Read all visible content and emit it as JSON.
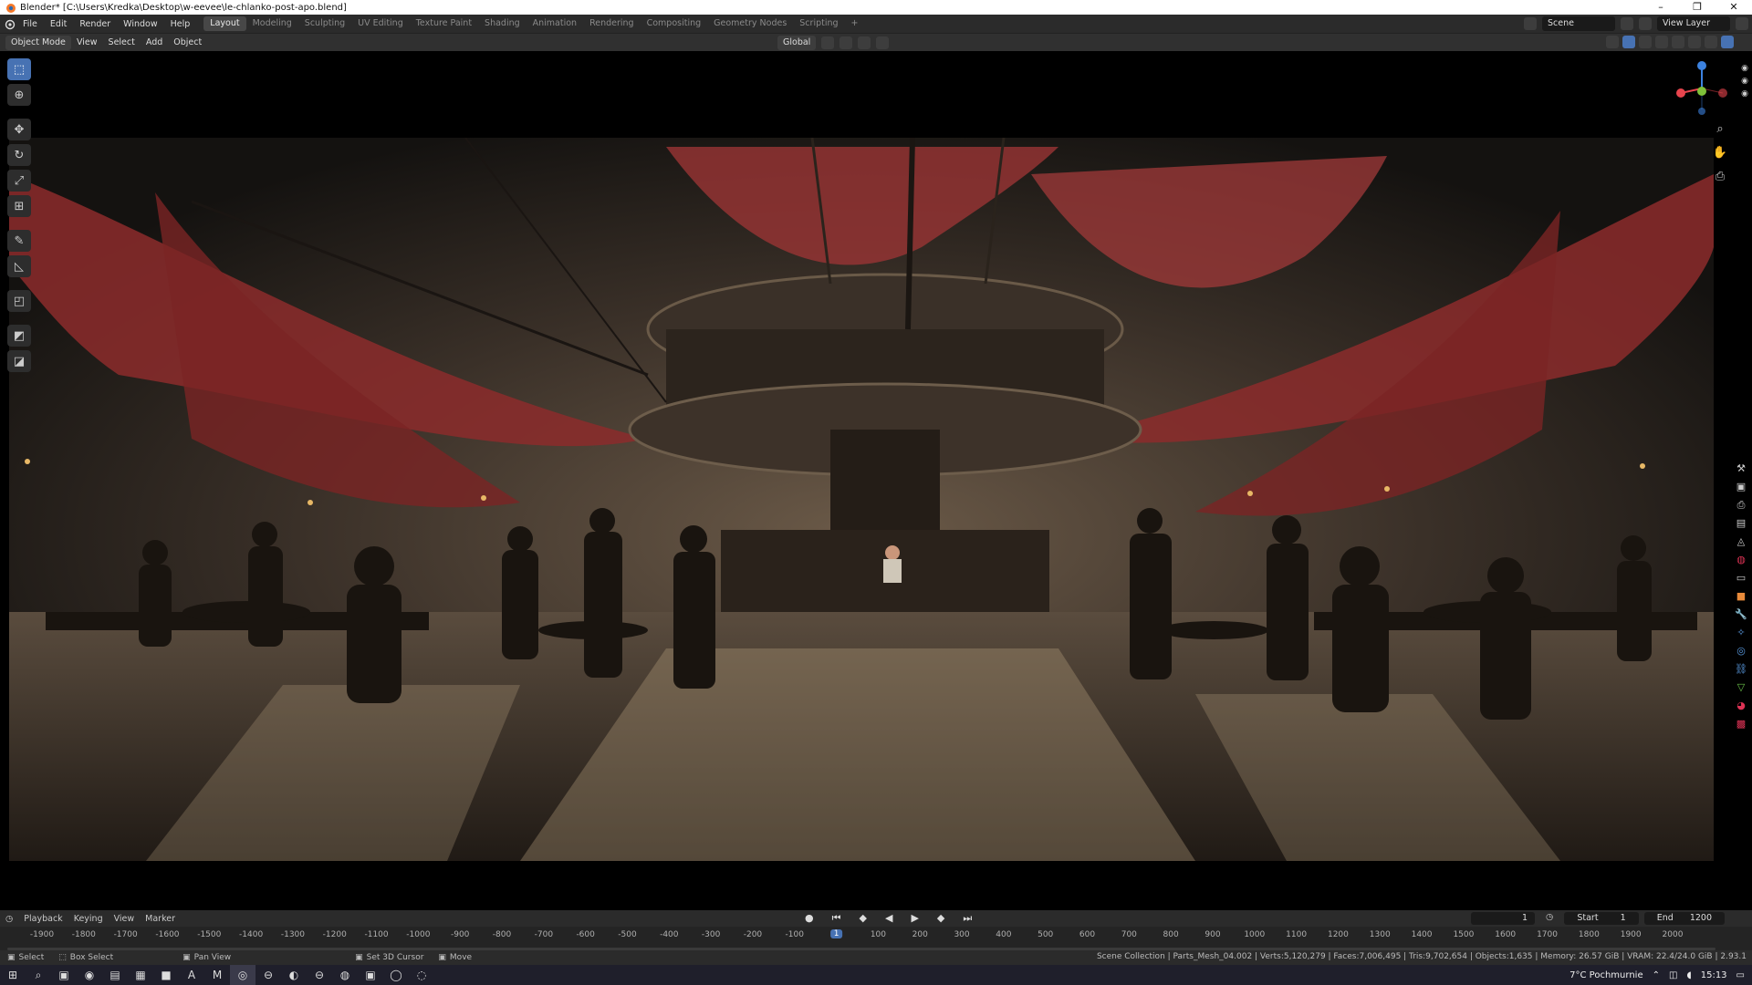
{
  "window": {
    "title": "Blender* [C:\\Users\\Kredka\\Desktop\\w-eevee\\le-chlanko-post-apo.blend]",
    "controls": [
      "–",
      "❐",
      "✕"
    ]
  },
  "topbar": {
    "menus": [
      "File",
      "Edit",
      "Render",
      "Window",
      "Help"
    ],
    "workspaces": [
      "Layout",
      "Modeling",
      "Sculpting",
      "UV Editing",
      "Texture Paint",
      "Shading",
      "Animation",
      "Rendering",
      "Compositing",
      "Geometry Nodes",
      "Scripting"
    ],
    "active_workspace": "Layout",
    "add_workspace": "+",
    "scene": "Scene",
    "view_layer": "View Layer"
  },
  "viewport_header": {
    "mode": "Object Mode",
    "menus": [
      "View",
      "Select",
      "Add",
      "Object"
    ],
    "orientation": "Global"
  },
  "toolbar": {
    "tools": [
      {
        "name": "select-box-tool",
        "icon": "⬚"
      },
      {
        "name": "cursor-tool",
        "icon": "⊕"
      },
      {
        "name": "move-tool",
        "icon": "✥"
      },
      {
        "name": "rotate-tool",
        "icon": "↻"
      },
      {
        "name": "scale-tool",
        "icon": "⤢"
      },
      {
        "name": "transform-tool",
        "icon": "⊞"
      },
      {
        "name": "annotate-tool",
        "icon": "✎"
      },
      {
        "name": "measure-tool",
        "icon": "◺"
      },
      {
        "name": "add-cube-tool",
        "icon": "◰"
      },
      {
        "name": "extra-tool-1",
        "icon": "◩"
      },
      {
        "name": "extra-tool-2",
        "icon": "◪"
      }
    ]
  },
  "gizmo": {
    "axes": [
      "X",
      "Y",
      "Z"
    ],
    "colors": {
      "x": "#e8444d",
      "y": "#7fc13a",
      "z": "#3c82e0"
    }
  },
  "timeline": {
    "menus": [
      "Playback",
      "Keying",
      "View",
      "Marker"
    ],
    "current_frame": "1",
    "start_label": "Start",
    "start": "1",
    "end_label": "End",
    "end": "1200",
    "ruler": [
      "-1900",
      "-1800",
      "-1700",
      "-1600",
      "-1500",
      "-1400",
      "-1300",
      "-1200",
      "-1100",
      "-1000",
      "-900",
      "-800",
      "-700",
      "-600",
      "-500",
      "-400",
      "-300",
      "-200",
      "-100",
      "1",
      "100",
      "200",
      "300",
      "400",
      "500",
      "600",
      "700",
      "800",
      "900",
      "1000",
      "1100",
      "1200",
      "1300",
      "1400",
      "1500",
      "1600",
      "1700",
      "1800",
      "1900",
      "2000"
    ],
    "playhead": "1"
  },
  "statusbar": {
    "select": "Select",
    "box_select": "Box Select",
    "pan_view": "Pan View",
    "set_3d_cursor": "Set 3D Cursor",
    "move": "Move",
    "stats": "Scene Collection | Parts_Mesh_04.002 | Verts:5,120,279 | Faces:7,006,495 | Tris:9,702,654 | Objects:1,635 | Memory: 26.57 GiB | VRAM: 22.4/24.0 GiB | 2.93.1"
  },
  "taskbar": {
    "weather": "7°C  Pochmurnie",
    "time": "15:13",
    "apps": [
      "⊞",
      "⌕",
      "▣",
      "◉",
      "▤",
      "▦",
      "■",
      "A",
      "M",
      "◎",
      "⊖",
      "◐",
      "⊖",
      "◍",
      "▣",
      "◯",
      "◌"
    ]
  },
  "colors": {
    "accent": "#4772b3",
    "bg": "#1d1d1d",
    "header": "#2b2b2b"
  }
}
